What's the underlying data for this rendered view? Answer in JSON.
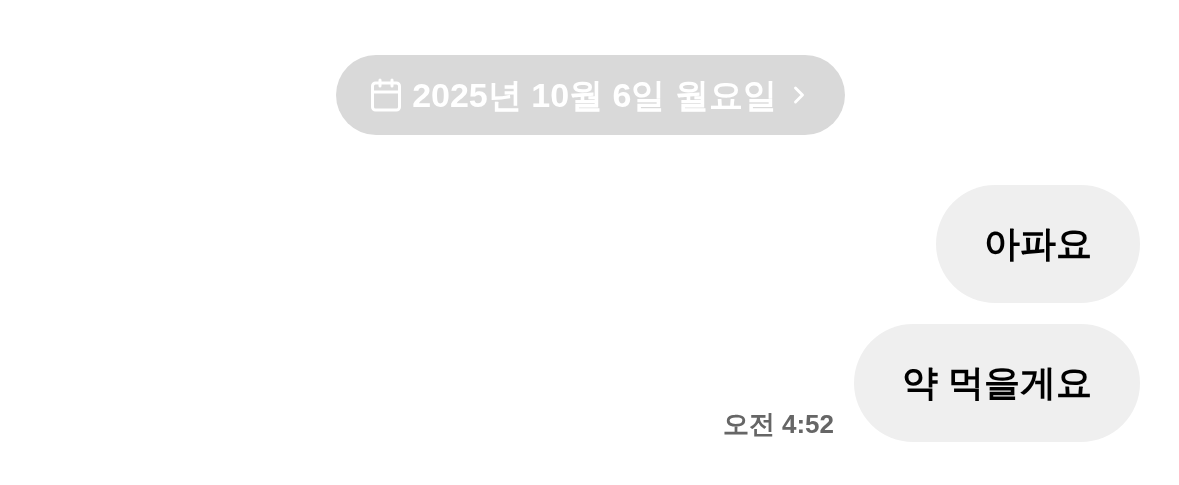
{
  "date_pill": {
    "label": "2025년 10월 6일 월요일"
  },
  "messages": [
    {
      "text": "아파요"
    },
    {
      "text": "약 먹을게요",
      "time": "오전 4:52"
    }
  ]
}
